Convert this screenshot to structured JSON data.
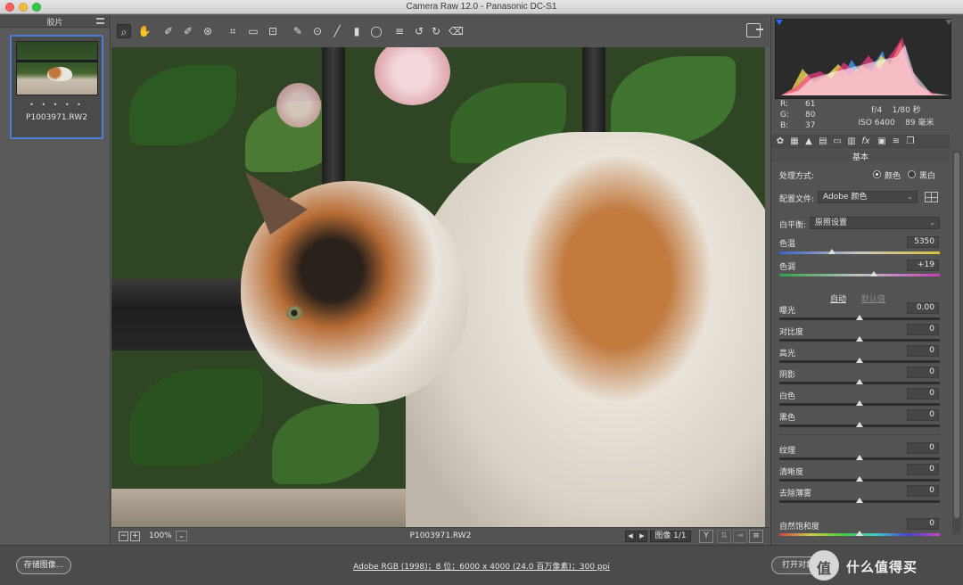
{
  "window": {
    "title": "Camera Raw 12.0 - Panasonic DC-S1"
  },
  "filmstrip": {
    "header": "胶片",
    "thumbnail": {
      "stars": "• • • • •",
      "filename": "P1003971.RW2"
    }
  },
  "toolbar": {
    "tools": [
      {
        "name": "zoom-tool",
        "glyph": "🔍"
      },
      {
        "name": "hand-tool",
        "glyph": "✋"
      },
      {
        "name": "white-balance-tool",
        "glyph": "⁄"
      },
      {
        "name": "color-sampler-tool",
        "glyph": "⁄"
      },
      {
        "name": "targeted-adjustment-tool",
        "glyph": "◎"
      },
      {
        "name": "crop-tool",
        "glyph": "⌗"
      },
      {
        "name": "straighten-tool",
        "glyph": "▭"
      },
      {
        "name": "transform-tool",
        "glyph": "⊡"
      },
      {
        "name": "spot-removal-tool",
        "glyph": "✎"
      },
      {
        "name": "red-eye-tool",
        "glyph": "⊙"
      },
      {
        "name": "adjustment-brush-tool",
        "glyph": "╱"
      },
      {
        "name": "graduated-filter-tool",
        "glyph": "▮"
      },
      {
        "name": "radial-filter-tool",
        "glyph": "◯"
      },
      {
        "name": "preferences-tool",
        "glyph": "≡"
      },
      {
        "name": "rotate-ccw-tool",
        "glyph": "↺"
      },
      {
        "name": "rotate-cw-tool",
        "glyph": "↻"
      },
      {
        "name": "trash-tool",
        "glyph": "🗑"
      }
    ]
  },
  "canvas_status": {
    "zoom": "100%",
    "filename": "P1003971.RW2",
    "image_count": "图像 1/1",
    "view_label": "Y"
  },
  "histogram_panel": {
    "r": "61",
    "g": "80",
    "b": "37",
    "r_label": "R:",
    "g_label": "G:",
    "b_label": "B:",
    "aperture": "f/4",
    "shutter": "1/80 秒",
    "iso": "ISO 6400",
    "focal": "89 毫米"
  },
  "basic_panel": {
    "section_title": "基本",
    "treatment_label": "处理方式:",
    "treatment_color": "颜色",
    "treatment_bw": "黑白",
    "profile_label": "配置文件:",
    "profile_value": "Adobe 颜色",
    "wb_label": "白平衡:",
    "wb_value": "原照设置",
    "temp_label": "色温",
    "temp_value": "5350",
    "tint_label": "色调",
    "tint_value": "+19",
    "auto_label": "自动",
    "default_label": "默认值",
    "sliders": [
      {
        "label": "曝光",
        "value": "0.00"
      },
      {
        "label": "对比度",
        "value": "0"
      },
      {
        "label": "高光",
        "value": "0"
      },
      {
        "label": "阴影",
        "value": "0"
      },
      {
        "label": "白色",
        "value": "0"
      },
      {
        "label": "黑色",
        "value": "0"
      }
    ],
    "sliders2": [
      {
        "label": "纹理",
        "value": "0"
      },
      {
        "label": "清晰度",
        "value": "0"
      },
      {
        "label": "去除薄雾",
        "value": "0"
      }
    ],
    "vibrance_label": "自然饱和度",
    "vibrance_value": "0"
  },
  "bottombar": {
    "save_label": "存储图像...",
    "workflow_link": "Adobe RGB (1998)；8 位；6000 x 4000 (24.0 百万像素)；300 ppi",
    "open_label": "打开对象",
    "watermark_text": "什么值得买",
    "watermark_logo": "值"
  }
}
